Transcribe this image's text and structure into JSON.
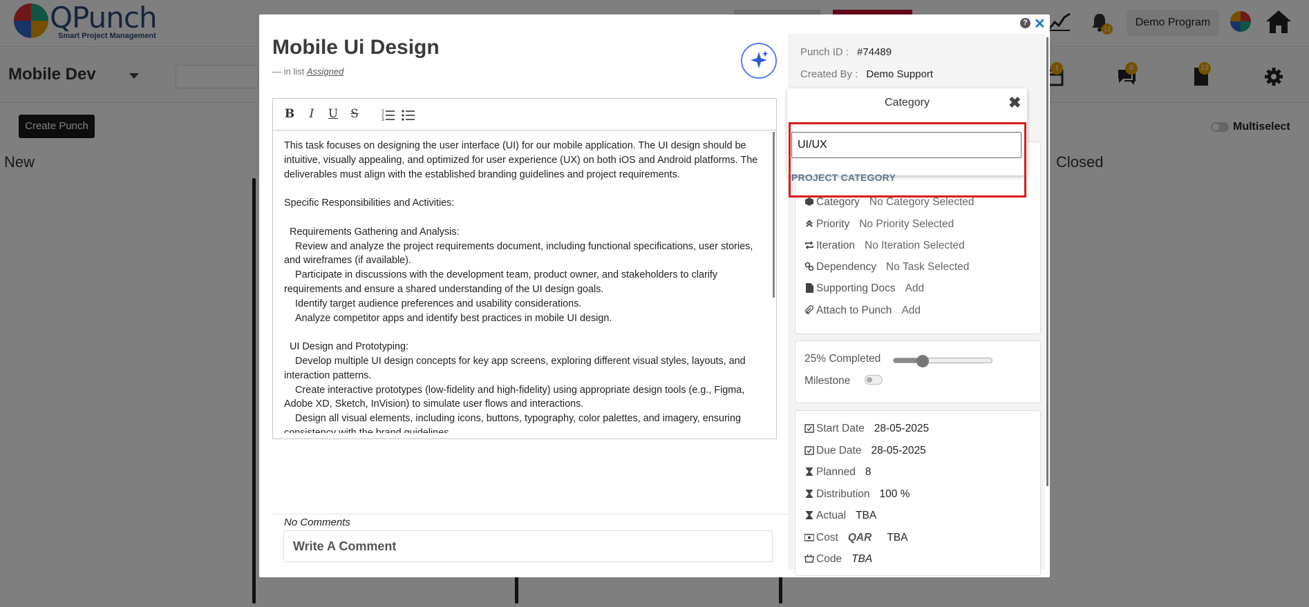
{
  "app": {
    "logo_text": "QPunch",
    "logo_subtitle": "Smart Project Management",
    "program_label": "Demo Program",
    "bell_count": "12"
  },
  "board": {
    "title": "Mobile Dev",
    "create_button": "Create Punch",
    "columns": [
      "New",
      "Closed"
    ],
    "multiselect_label": "Multiselect",
    "badges": [
      "1",
      "0",
      "12"
    ]
  },
  "modal": {
    "title": "Mobile Ui Design",
    "in_list_prefix": "—  in list",
    "in_list_name": "Assigned",
    "toolbar": {
      "bold": "B",
      "italic": "I",
      "underline": "U",
      "strike": "S"
    },
    "description": "This task focuses on designing the user interface (UI) for our mobile application. The UI design should be intuitive, visually appealing, and optimized for user experience (UX) on both iOS and Android platforms. The deliverables must align with the established branding guidelines and project requirements.\n\nSpecific Responsibilities and Activities:\n\n  Requirements Gathering and Analysis:\n    Review and analyze the project requirements document, including functional specifications, user stories, and wireframes (if available).\n    Participate in discussions with the development team, product owner, and stakeholders to clarify requirements and ensure a shared understanding of the UI design goals.\n    Identify target audience preferences and usability considerations.\n    Analyze competitor apps and identify best practices in mobile UI design.\n\n  UI Design and Prototyping:\n    Develop multiple UI design concepts for key app screens, exploring different visual styles, layouts, and interaction patterns.\n    Create interactive prototypes (low-fidelity and high-fidelity) using appropriate design tools (e.g., Figma, Adobe XD, Sketch, InVision) to simulate user flows and interactions.\n    Design all visual elements, including icons, buttons, typography, color palettes, and imagery, ensuring consistency with the brand guidelines.",
    "no_comments": "No Comments",
    "comment_placeholder": "Write A Comment"
  },
  "details": {
    "punch_id_label": "Punch ID :",
    "punch_id": "#74489",
    "created_by_label": "Created By :",
    "created_by": "Demo Support",
    "fields": [
      {
        "label": "Category",
        "value": "No Category Selected",
        "icon": "cube-icon"
      },
      {
        "label": "Priority",
        "value": "No Priority Selected",
        "icon": "chevrons-up-icon"
      },
      {
        "label": "Iteration",
        "value": "No Iteration Selected",
        "icon": "repeat-icon"
      },
      {
        "label": "Dependency",
        "value": "No Task Selected",
        "icon": "link-icon"
      },
      {
        "label": "Supporting Docs",
        "value": "Add",
        "icon": "file-icon"
      },
      {
        "label": "Attach to Punch",
        "value": "Add",
        "icon": "paperclip-icon"
      }
    ],
    "progress_label": "25% Completed",
    "progress_percent": 25,
    "milestone_label": "Milestone",
    "milestone_on": false,
    "schedule": [
      {
        "label": "Start Date",
        "value": "28-05-2025",
        "icon": "calendar-check-icon"
      },
      {
        "label": "Due Date",
        "value": "28-05-2025",
        "icon": "calendar-check-icon"
      },
      {
        "label": "Planned",
        "value": "8",
        "icon": "hourglass-icon"
      },
      {
        "label": "Distribution",
        "value": "100 %",
        "icon": "hourglass-icon"
      },
      {
        "label": "Actual",
        "value": "TBA",
        "icon": "hourglass-icon"
      },
      {
        "label": "Cost",
        "currency": "QAR",
        "value": "TBA",
        "icon": "money-icon"
      },
      {
        "label": "Code",
        "value": "TBA",
        "icon": "barcode-icon"
      }
    ]
  },
  "category_popup": {
    "title": "Category",
    "input_value": "UI/UX",
    "option": "PROJECT CATEGORY"
  },
  "colors": {
    "accent_blue": "#1976d2",
    "highlight_red": "#d81b1b",
    "option_blue": "#5d7592",
    "brand_navy": "#2f4a7a"
  }
}
